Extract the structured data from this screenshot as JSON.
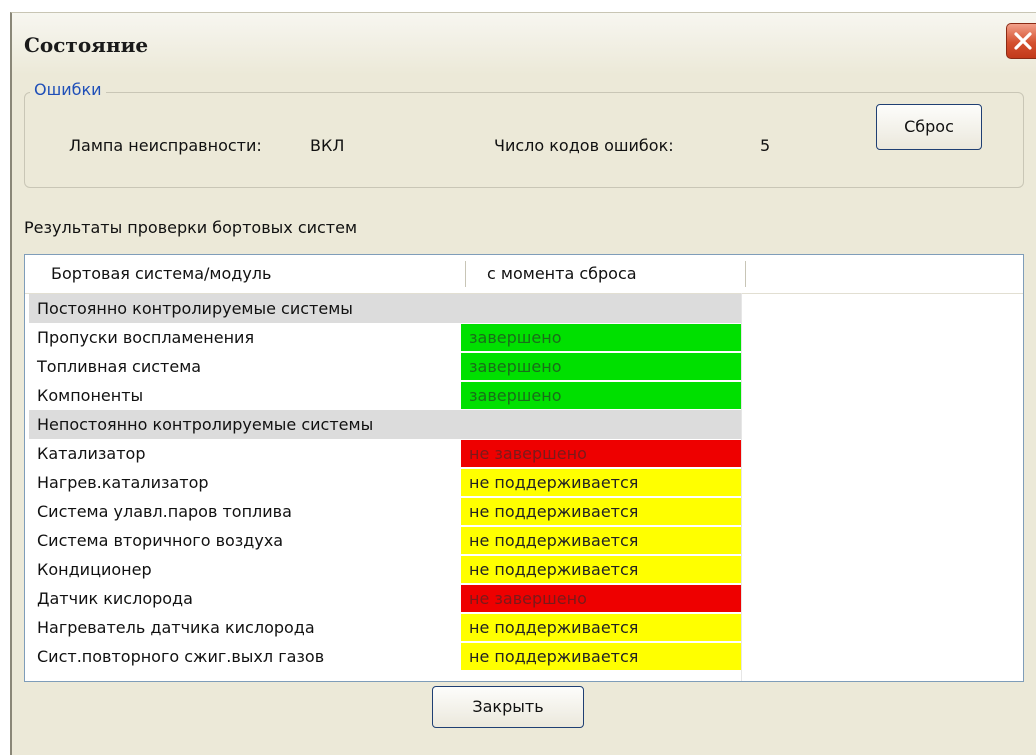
{
  "window": {
    "title": "Состояние"
  },
  "errors": {
    "group_title": "Ошибки",
    "lamp_label": "Лампа неисправности:",
    "lamp_value": "ВКЛ",
    "count_label": "Число кодов ошибок:",
    "count_value": "5",
    "reset_button": "Сброс"
  },
  "results": {
    "title": "Результаты проверки бортовых систем",
    "columns": [
      "Бортовая система/модуль",
      "с момента сброса"
    ],
    "rows": [
      {
        "name": "Постоянно контролируемые системы",
        "category": true
      },
      {
        "name": "Пропуски воспламенения",
        "status": "завершено",
        "color": "#00e000",
        "text_color": "#1a6d1a"
      },
      {
        "name": "Топливная система",
        "status": "завершено",
        "color": "#00e000",
        "text_color": "#1a6d1a"
      },
      {
        "name": "Компоненты",
        "status": "завершено",
        "color": "#00e000",
        "text_color": "#1a6d1a"
      },
      {
        "name": "Непостоянно контролируемые системы",
        "category": true
      },
      {
        "name": "Катализатор",
        "status": "не завершено",
        "color": "#ee0000",
        "text_color": "#7a1a1a"
      },
      {
        "name": "Нагрев.катализатор",
        "status": "не поддерживается",
        "color": "#ffff00",
        "text_color": "#222222"
      },
      {
        "name": "Система улавл.паров топлива",
        "status": "не поддерживается",
        "color": "#ffff00",
        "text_color": "#222222"
      },
      {
        "name": "Система вторичного воздуха",
        "status": "не поддерживается",
        "color": "#ffff00",
        "text_color": "#222222"
      },
      {
        "name": "Кондиционер",
        "status": "не поддерживается",
        "color": "#ffff00",
        "text_color": "#222222"
      },
      {
        "name": "Датчик кислорода",
        "status": "не завершено",
        "color": "#ee0000",
        "text_color": "#7a1a1a"
      },
      {
        "name": "Нагреватель датчика кислорода",
        "status": "не поддерживается",
        "color": "#ffff00",
        "text_color": "#222222"
      },
      {
        "name": "Сист.повторного сжиг.выхл газов",
        "status": "не поддерживается",
        "color": "#ffff00",
        "text_color": "#222222"
      }
    ]
  },
  "footer": {
    "close_button": "Закрыть"
  }
}
